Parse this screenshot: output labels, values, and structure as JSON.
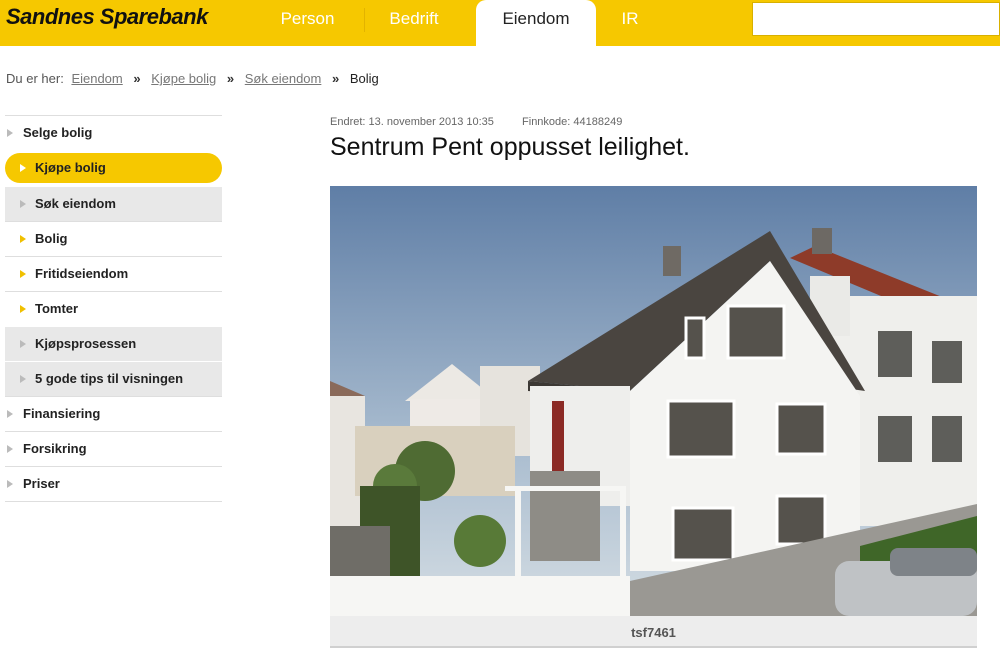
{
  "header": {
    "brand": "Sandnes Sparebank",
    "nav": [
      {
        "label": "Person",
        "active": false
      },
      {
        "label": "Bedrift",
        "active": false
      },
      {
        "label": "Eiendom",
        "active": true
      },
      {
        "label": "IR",
        "active": false
      }
    ],
    "search_placeholder": ""
  },
  "breadcrumb": {
    "prefix": "Du er her:",
    "links": [
      "Eiendom",
      "Kjøpe bolig",
      "Søk eiendom"
    ],
    "current": "Bolig",
    "separator": "»"
  },
  "sidebar": {
    "items": [
      {
        "label": "Selge bolig",
        "level": 0,
        "active": false
      },
      {
        "label": "Kjøpe bolig",
        "level": 1,
        "active": true
      },
      {
        "label": "Søk eiendom",
        "level": 2,
        "active": false
      },
      {
        "label": "Bolig",
        "level": 1,
        "active": false
      },
      {
        "label": "Fritidseiendom",
        "level": 1,
        "active": false
      },
      {
        "label": "Tomter",
        "level": 1,
        "active": false
      },
      {
        "label": "Kjøpsprosessen",
        "level": 2,
        "active": false
      },
      {
        "label": "5 gode tips til visningen",
        "level": 2,
        "active": false
      },
      {
        "label": "Finansiering",
        "level": 0,
        "active": false
      },
      {
        "label": "Forsikring",
        "level": 0,
        "active": false
      },
      {
        "label": "Priser",
        "level": 0,
        "active": false
      }
    ]
  },
  "listing": {
    "changed_label": "Endret:",
    "changed_value": "13. november 2013 10:35",
    "finnkode_label": "Finnkode:",
    "finnkode_value": "44188249",
    "title": "Sentrum Pent oppusset leilighet.",
    "photo_caption": "tsf7461"
  },
  "colors": {
    "brand_yellow": "#f6c800",
    "house_white": "#f4f4f2",
    "roof_dark": "#4a4540",
    "roof_red": "#9a3f2c"
  }
}
